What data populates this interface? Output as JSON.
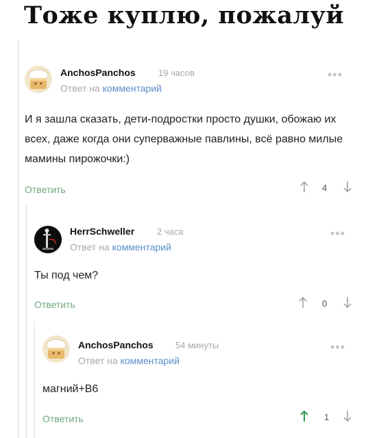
{
  "page": {
    "title": "Тоже куплю, пожалуй"
  },
  "comments": [
    {
      "username": "AnchosPanchos",
      "time": "19 часов",
      "reply_prefix": "Ответ на",
      "reply_link": "комментарий",
      "text": "И я зашла сказать, дети-подростки просто душки, обожаю их всех, даже когда они суперважные павлины, всё равно милые мамины пирожочки:)",
      "reply_label": "Ответить",
      "rating": "4",
      "upvoted": false
    },
    {
      "username": "HerrSchweller",
      "time": "2 часа",
      "reply_prefix": "Ответ на",
      "reply_link": "комментарий",
      "text": "Ты под чем?",
      "reply_label": "Ответить",
      "rating": "0",
      "upvoted": false
    },
    {
      "username": "AnchosPanchos",
      "time": "54 минуты",
      "reply_prefix": "Ответ на",
      "reply_link": "комментарий",
      "text": "магний+B6",
      "reply_label": "Ответить",
      "rating": "1",
      "upvoted": true
    }
  ],
  "icons": {
    "more": "more-dots-icon",
    "upvote": "arrow-up-icon",
    "downvote": "arrow-down-icon"
  },
  "colors": {
    "reply_action": "#6fa77e",
    "link": "#5a8cc8",
    "meta": "#a8a8a8",
    "upvote_active": "#2e9e4f"
  }
}
